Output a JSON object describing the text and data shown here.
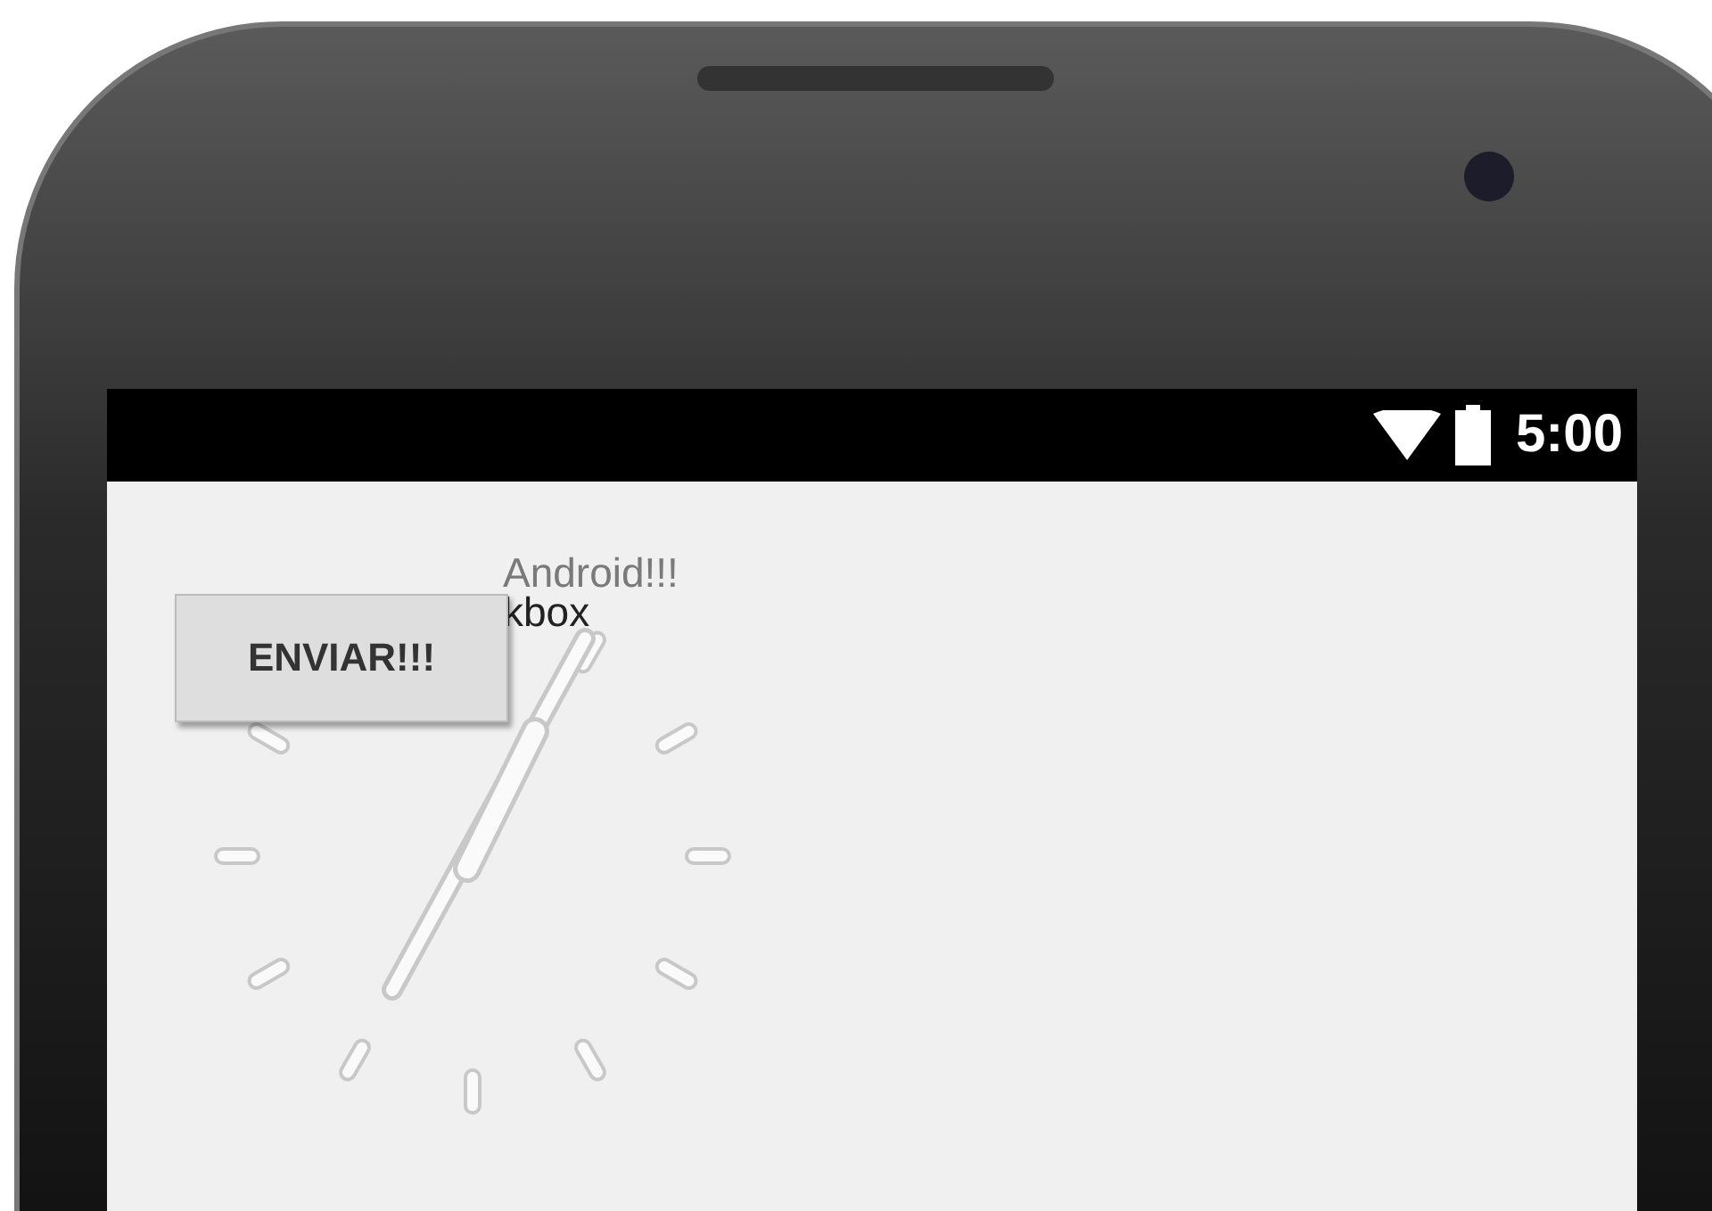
{
  "status_bar": {
    "time": "5:00"
  },
  "welcome_text": "Android!!!",
  "checkbox": {
    "label": "kbox"
  },
  "button": {
    "label": "ENVIAR!!!"
  }
}
